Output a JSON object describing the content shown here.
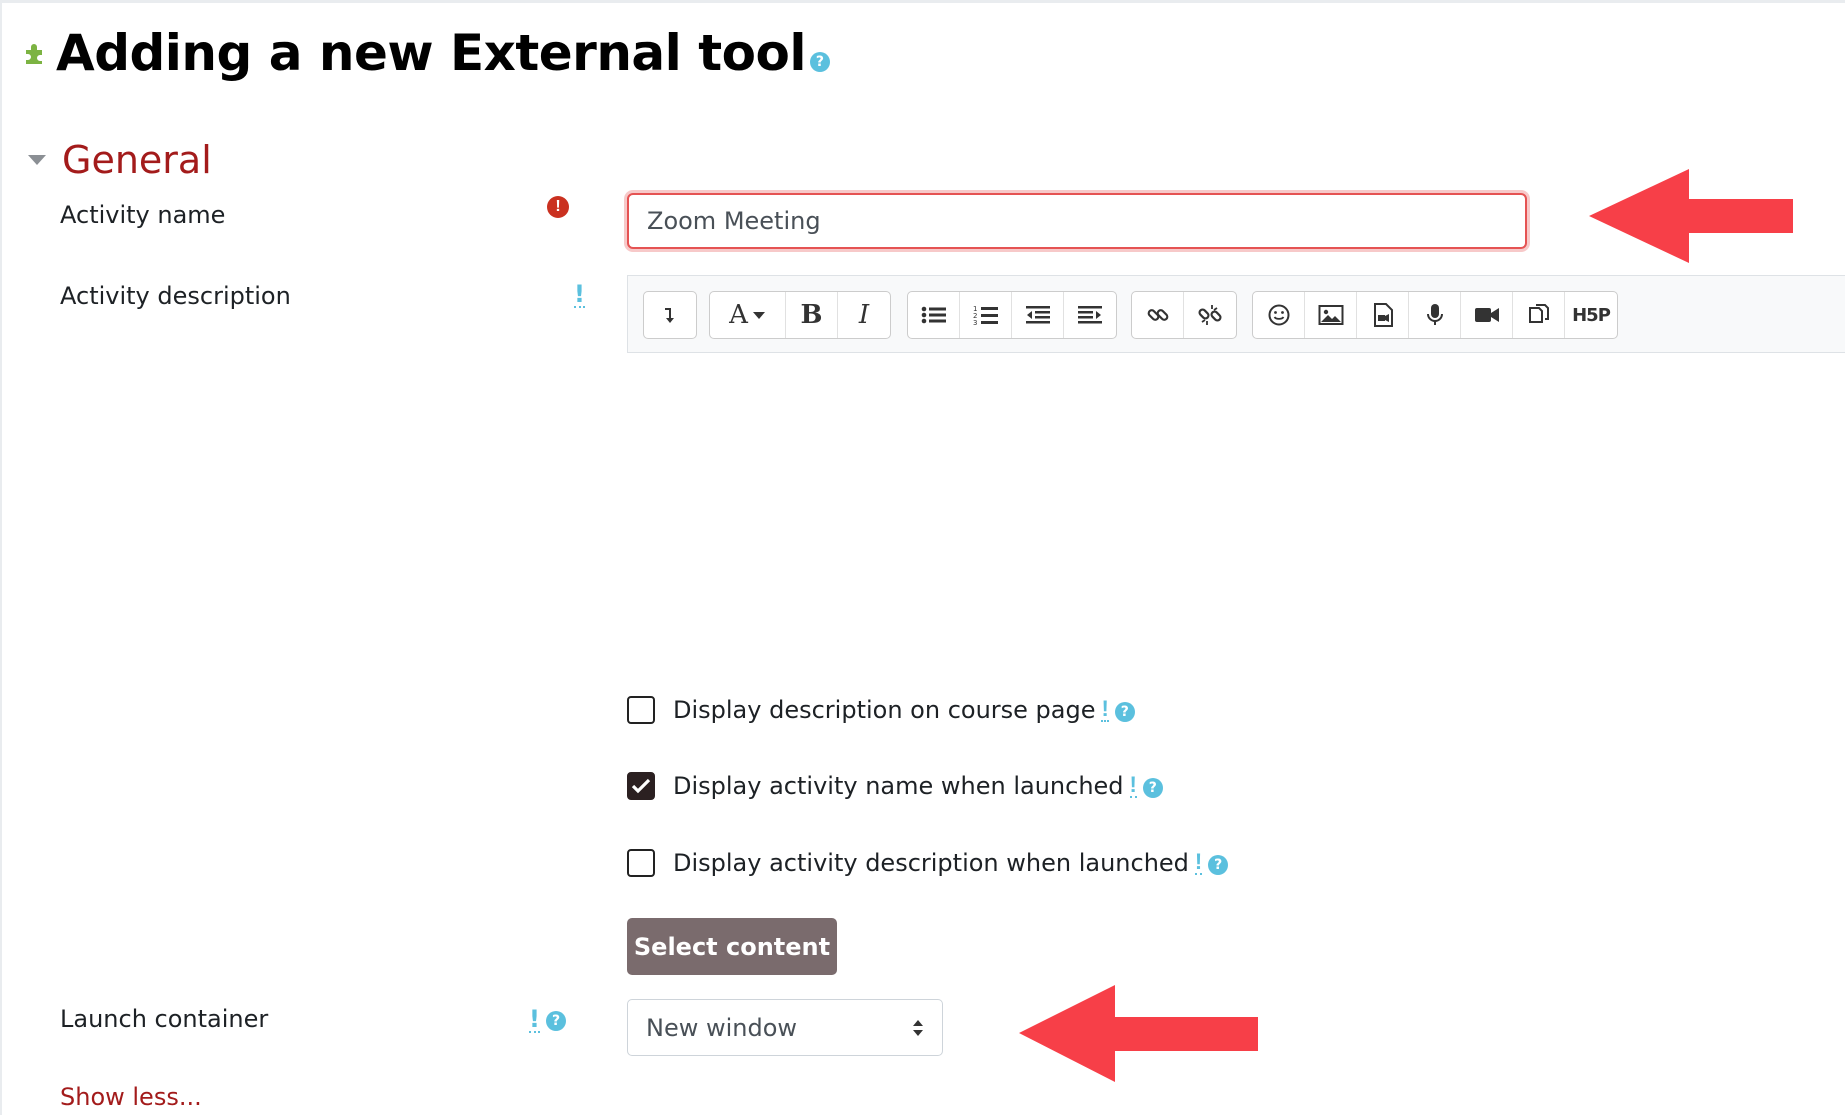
{
  "page": {
    "title": "Adding a new External tool",
    "title_help_icon": "?",
    "plugin_icon": "puzzle-icon"
  },
  "general": {
    "section_title": "General",
    "activity_name": {
      "label": "Activity name",
      "value": "Zoom Meeting",
      "required_icon": "!"
    },
    "activity_description": {
      "label": "Activity description",
      "info_icon": "!"
    },
    "editor_toolbar": [
      {
        "group": "collapse",
        "buttons": [
          "expand-toolbar-icon"
        ]
      },
      {
        "group": "style",
        "buttons": [
          "paragraph-styles-icon",
          "bold-icon",
          "italic-icon"
        ]
      },
      {
        "group": "list",
        "buttons": [
          "unordered-list-icon",
          "ordered-list-icon",
          "outdent-icon",
          "indent-icon"
        ]
      },
      {
        "group": "links",
        "buttons": [
          "link-icon",
          "unlink-icon"
        ]
      },
      {
        "group": "files",
        "buttons": [
          "emoji-icon",
          "image-icon",
          "media-icon",
          "record-audio-icon",
          "record-video-icon",
          "manage-files-icon",
          "h5p-icon"
        ]
      }
    ],
    "checkboxes": [
      {
        "label": "Display description on course page",
        "checked": false
      },
      {
        "label": "Display activity name when launched",
        "checked": true
      },
      {
        "label": "Display activity description when launched",
        "checked": false
      }
    ],
    "select_content_label": "Select content",
    "launch_container": {
      "label": "Launch container",
      "value": "New window"
    },
    "show_less_label": "Show less..."
  },
  "colors": {
    "accent_red": "#a31b1b",
    "help_blue": "#5bc0de",
    "annotation_arrow": "#f73f48",
    "button_bg": "#7a6b6d"
  }
}
